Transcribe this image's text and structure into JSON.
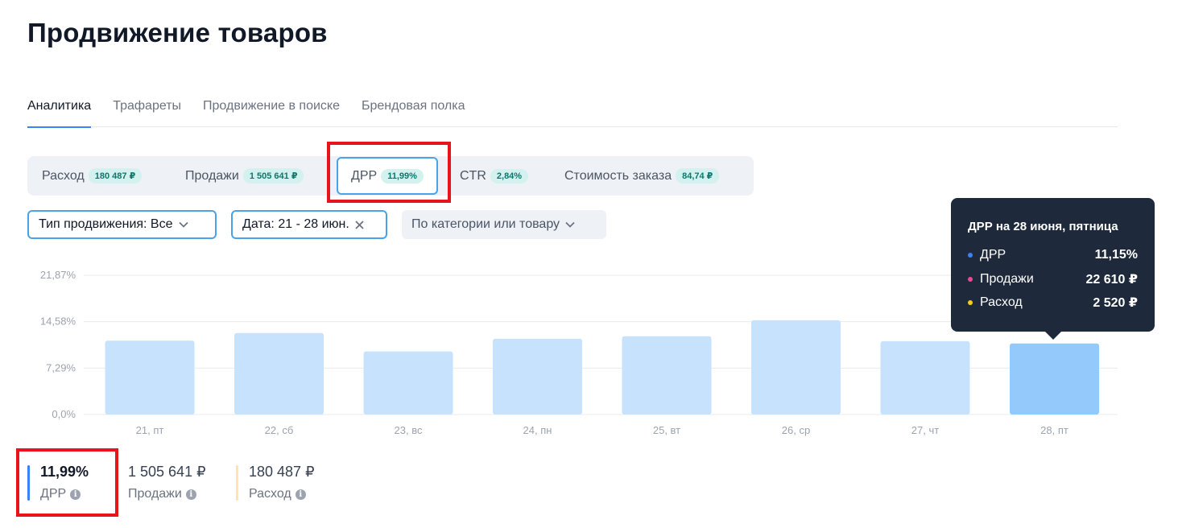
{
  "page": {
    "title": "Продвижение товаров"
  },
  "tabs": [
    {
      "label": "Аналитика",
      "active": true
    },
    {
      "label": "Трафареты",
      "active": false
    },
    {
      "label": "Продвижение в поиске",
      "active": false
    },
    {
      "label": "Брендовая полка",
      "active": false
    }
  ],
  "metrics": [
    {
      "label": "Расход",
      "badge": "180 487 ₽",
      "selected": false
    },
    {
      "label": "Продажи",
      "badge": "1 505 641 ₽",
      "selected": false
    },
    {
      "label": "ДРР",
      "badge": "11,99%",
      "selected": true
    },
    {
      "label": "CTR",
      "badge": "2,84%",
      "selected": false
    },
    {
      "label": "Стоимость заказа",
      "badge": "84,74 ₽",
      "selected": false
    }
  ],
  "filters": {
    "type": {
      "label": "Тип продвижения: Все",
      "icon": "chevron-down-icon"
    },
    "date": {
      "label": "Дата: 21 - 28 июн.",
      "icon": "close-icon"
    },
    "category": {
      "label": "По категории или товару",
      "icon": "chevron-down-icon"
    }
  },
  "colors": {
    "accent": "#3b82f6",
    "bar": "#c7e2fd",
    "bar_active": "#93c9fb",
    "highlight": "#e8141b",
    "badge_bg": "#d3f1ee",
    "tooltip_bg": "#1e293b"
  },
  "chart_data": {
    "type": "bar",
    "categories": [
      "21, пт",
      "22, сб",
      "23, вс",
      "24, пн",
      "25, вт",
      "26, ср",
      "27, чт",
      "28, пт"
    ],
    "values": [
      11.6,
      12.8,
      9.9,
      11.9,
      12.3,
      14.8,
      11.5,
      11.15
    ],
    "y_ticks": [
      "0,0%",
      "7,29%",
      "14,58%",
      "21,87%"
    ],
    "y_tick_values": [
      0,
      7.29,
      14.58,
      21.87
    ],
    "ylim": [
      0,
      21.87
    ],
    "grid": true,
    "active_index": 7
  },
  "tooltip": {
    "title": "ДРР на 28 июня, пятница",
    "rows": [
      {
        "label": "ДРР",
        "value": "11,15%",
        "color": "#3b82f6"
      },
      {
        "label": "Продажи",
        "value": "22 610 ₽",
        "color": "#ec4899"
      },
      {
        "label": "Расход",
        "value": "2 520 ₽",
        "color": "#facc15"
      }
    ]
  },
  "summary": [
    {
      "value": "11,99%",
      "label": "ДРР",
      "color": "#3b82f6"
    },
    {
      "value": "1 505 641 ₽",
      "label": "Продажи",
      "color": "#ffffff"
    },
    {
      "value": "180 487 ₽",
      "label": "Расход",
      "color": "#fde7a5"
    }
  ]
}
